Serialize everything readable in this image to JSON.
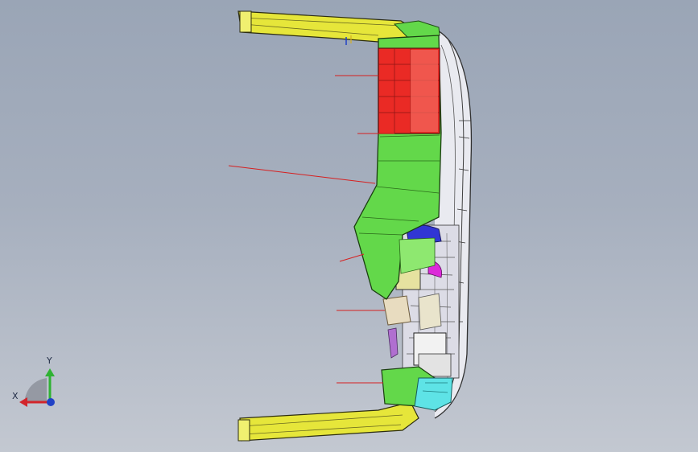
{
  "viewport": {
    "background_top": "#9aa5b6",
    "background_bottom": "#c3c8d1"
  },
  "triad": {
    "x_label": "X",
    "y_label": "Y",
    "x_color": "#d2252b",
    "y_color": "#2fb233",
    "z_color": "#2142c6"
  },
  "model": {
    "part_colors": {
      "frame": "#e6e63a",
      "body": "#63d84a",
      "upper_block": "#ea2a25",
      "magenta": "#dc2ad9",
      "blue": "#3136d4",
      "cyan": "#5ee3e6",
      "beige": "#e8dcc0",
      "leader": "#d62020"
    },
    "leader_line_count": 7
  }
}
